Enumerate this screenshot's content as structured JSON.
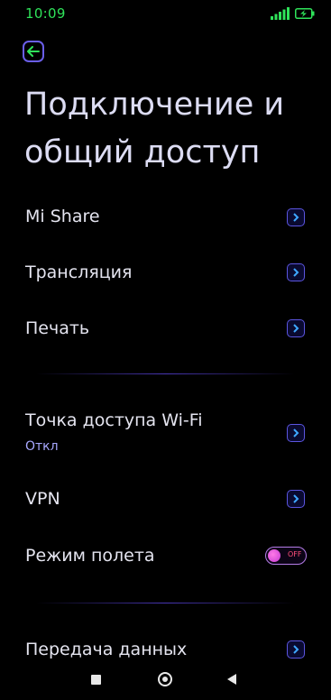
{
  "status": {
    "time": "10:09",
    "accent_color": "#2fe35a",
    "icons": [
      "signal-icon",
      "battery-charging-icon"
    ]
  },
  "header": {
    "back_icon": "arrow-left-icon",
    "title_line1": "Подключение и",
    "title_line2": "общий доступ"
  },
  "sections": [
    {
      "items": [
        {
          "label": "Mi Share",
          "control": "chevron"
        },
        {
          "label": "Трансляция",
          "control": "chevron"
        },
        {
          "label": "Печать",
          "control": "chevron"
        }
      ]
    },
    {
      "items": [
        {
          "label": "Точка доступа Wi-Fi",
          "sublabel": "Откл",
          "control": "chevron"
        },
        {
          "label": "VPN",
          "control": "chevron"
        },
        {
          "label": "Режим полета",
          "control": "toggle",
          "toggle_text": "OFF",
          "checked": false
        }
      ]
    },
    {
      "items": [
        {
          "label": "Передача данных",
          "control": "chevron"
        }
      ]
    }
  ],
  "colors": {
    "background": "#000000",
    "accent": "#5b55e0",
    "sublabel": "#a8a8ff",
    "toggle_knob": "#e060e8"
  },
  "nav": {
    "icons": [
      "recents-icon",
      "home-icon",
      "back-icon"
    ]
  }
}
